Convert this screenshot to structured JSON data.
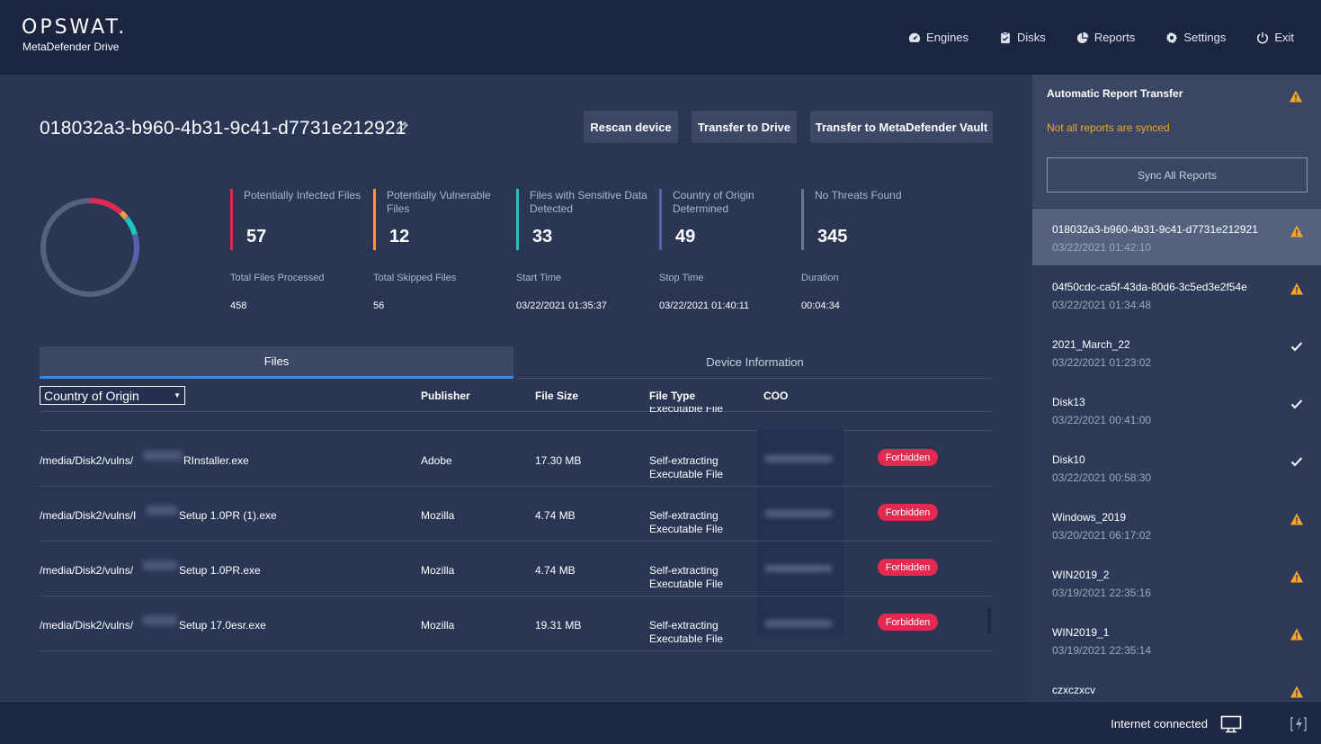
{
  "app": {
    "brand": "OPSWAT.",
    "product": "MetaDefender Drive"
  },
  "nav": [
    {
      "label": "Engines",
      "icon": "gauge-icon"
    },
    {
      "label": "Disks",
      "icon": "clipboard-check-icon"
    },
    {
      "label": "Reports",
      "icon": "pie-chart-icon"
    },
    {
      "label": "Settings",
      "icon": "gear-icon"
    },
    {
      "label": "Exit",
      "icon": "power-icon"
    }
  ],
  "device": {
    "id": "018032a3-b960-4b31-9c41-d7731e212921"
  },
  "actions": {
    "rescan": "Rescan device",
    "transfer_drive": "Transfer to Drive",
    "transfer_vault": "Transfer to MetaDefender Vault"
  },
  "stats": [
    {
      "label": "Potentially Infected Files",
      "value": "57",
      "color": "#e3294f"
    },
    {
      "label": "Potentially Vulnerable Files",
      "value": "12",
      "color": "#f39b3f"
    },
    {
      "label": "Files with Sensitive Data Detected",
      "value": "33",
      "color": "#1ec6c2"
    },
    {
      "label": "Country of Origin Determined",
      "value": "49",
      "color": "#5b5fb0"
    },
    {
      "label": "No Threats Found",
      "value": "345",
      "color": "#6a7592"
    }
  ],
  "meta": [
    {
      "label": "Total Files Processed",
      "value": "458"
    },
    {
      "label": "Total Skipped Files",
      "value": "56"
    },
    {
      "label": "Start Time",
      "value": "03/22/2021 01:35:37"
    },
    {
      "label": "Stop Time",
      "value": "03/22/2021 01:40:11"
    },
    {
      "label": "Duration",
      "value": "00:04:34"
    }
  ],
  "tabs": {
    "files": "Files",
    "device_info": "Device Information"
  },
  "table": {
    "filter_selected": "Country of Origin",
    "headers": {
      "publisher": "Publisher",
      "size": "File Size",
      "type": "File Type",
      "coo": "COO"
    },
    "clipped_prev_type": "Executable File",
    "rows": [
      {
        "prefix": "/media/Disk2/vulns/",
        "suffix": "RInstaller.exe",
        "publisher": "Adobe",
        "size": "17.30 MB",
        "type1": "Self-extracting",
        "type2": "Executable File",
        "status": "Forbidden"
      },
      {
        "prefix": "/media/Disk2/vulns/I",
        "suffix": "Setup 1.0PR (1).exe",
        "publisher": "Mozilla",
        "size": "4.74 MB",
        "type1": "Self-extracting",
        "type2": "Executable File",
        "status": "Forbidden"
      },
      {
        "prefix": "/media/Disk2/vulns/",
        "suffix": "Setup 1.0PR.exe",
        "publisher": "Mozilla",
        "size": "4.74 MB",
        "type1": "Self-extracting",
        "type2": "Executable File",
        "status": "Forbidden"
      },
      {
        "prefix": "/media/Disk2/vulns/",
        "suffix": "Setup 17.0esr.exe",
        "publisher": "Mozilla",
        "size": "19.31 MB",
        "type1": "Self-extracting",
        "type2": "Executable File",
        "status": "Forbidden"
      }
    ]
  },
  "sidebar": {
    "title": "Automatic Report Transfer",
    "status": "Not all reports are synced",
    "sync_button": "Sync All Reports",
    "reports": [
      {
        "name": "018032a3-b960-4b31-9c41-d7731e212921",
        "date": "03/22/2021 01:42:10",
        "state": "warning"
      },
      {
        "name": "04f50cdc-ca5f-43da-80d6-3c5ed3e2f54e",
        "date": "03/22/2021 01:34:48",
        "state": "warning"
      },
      {
        "name": "2021_March_22",
        "date": "03/22/2021 01:23:02",
        "state": "synced"
      },
      {
        "name": "Disk13",
        "date": "03/22/2021 00:41:00",
        "state": "synced"
      },
      {
        "name": "Disk10",
        "date": "03/22/2021 00:58:30",
        "state": "synced"
      },
      {
        "name": "Windows_2019",
        "date": "03/20/2021 06:17:02",
        "state": "warning"
      },
      {
        "name": "WIN2019_2",
        "date": "03/19/2021 22:35:16",
        "state": "warning"
      },
      {
        "name": "WIN2019_1",
        "date": "03/19/2021 22:35:14",
        "state": "warning"
      },
      {
        "name": "czxczxcv",
        "date": "",
        "state": "warning"
      }
    ]
  },
  "footer": {
    "connection": "Internet connected"
  },
  "colors": {
    "accent": "#2d8cf0",
    "warning": "#f5a623",
    "danger": "#e3294f"
  }
}
